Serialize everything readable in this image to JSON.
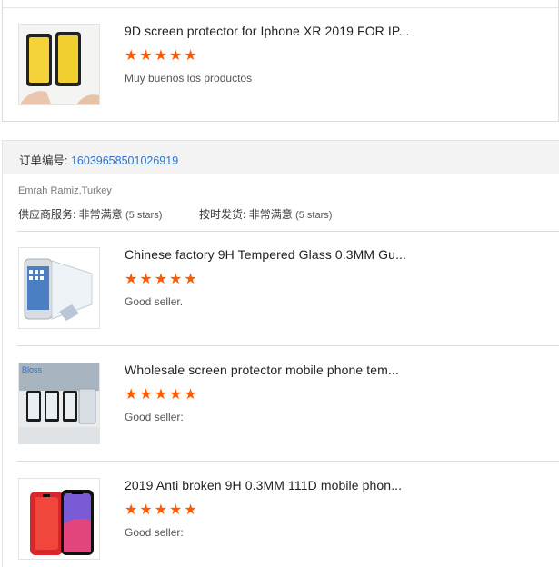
{
  "top_item": {
    "title": "9D screen protector for Iphone XR 2019 FOR IP...",
    "stars": "★★★★★",
    "comment": "Muy buenos los productos"
  },
  "order": {
    "label": "订单编号:",
    "number": "16039658501026919",
    "buyer": "Emrah Ramiz,Turkey",
    "supplier_service_label": "供应商服务: 非常满意",
    "supplier_service_stars": "(5 stars)",
    "shipping_label": "按时发货: 非常满意",
    "shipping_stars": "(5 stars)"
  },
  "items": [
    {
      "title": "Chinese factory 9H Tempered Glass 0.3MM Gu...",
      "stars": "★★★★★",
      "comment": "Good seller."
    },
    {
      "title": "Wholesale screen protector mobile phone tem...",
      "stars": "★★★★★",
      "comment": "Good seller:",
      "thumb_text": "Bloss"
    },
    {
      "title": "2019 Anti broken 9H 0.3MM 111D mobile phon...",
      "stars": "★★★★★",
      "comment": "Good seller:"
    }
  ],
  "colors": {
    "star": "#ff5a00",
    "link": "#2a73cc"
  }
}
